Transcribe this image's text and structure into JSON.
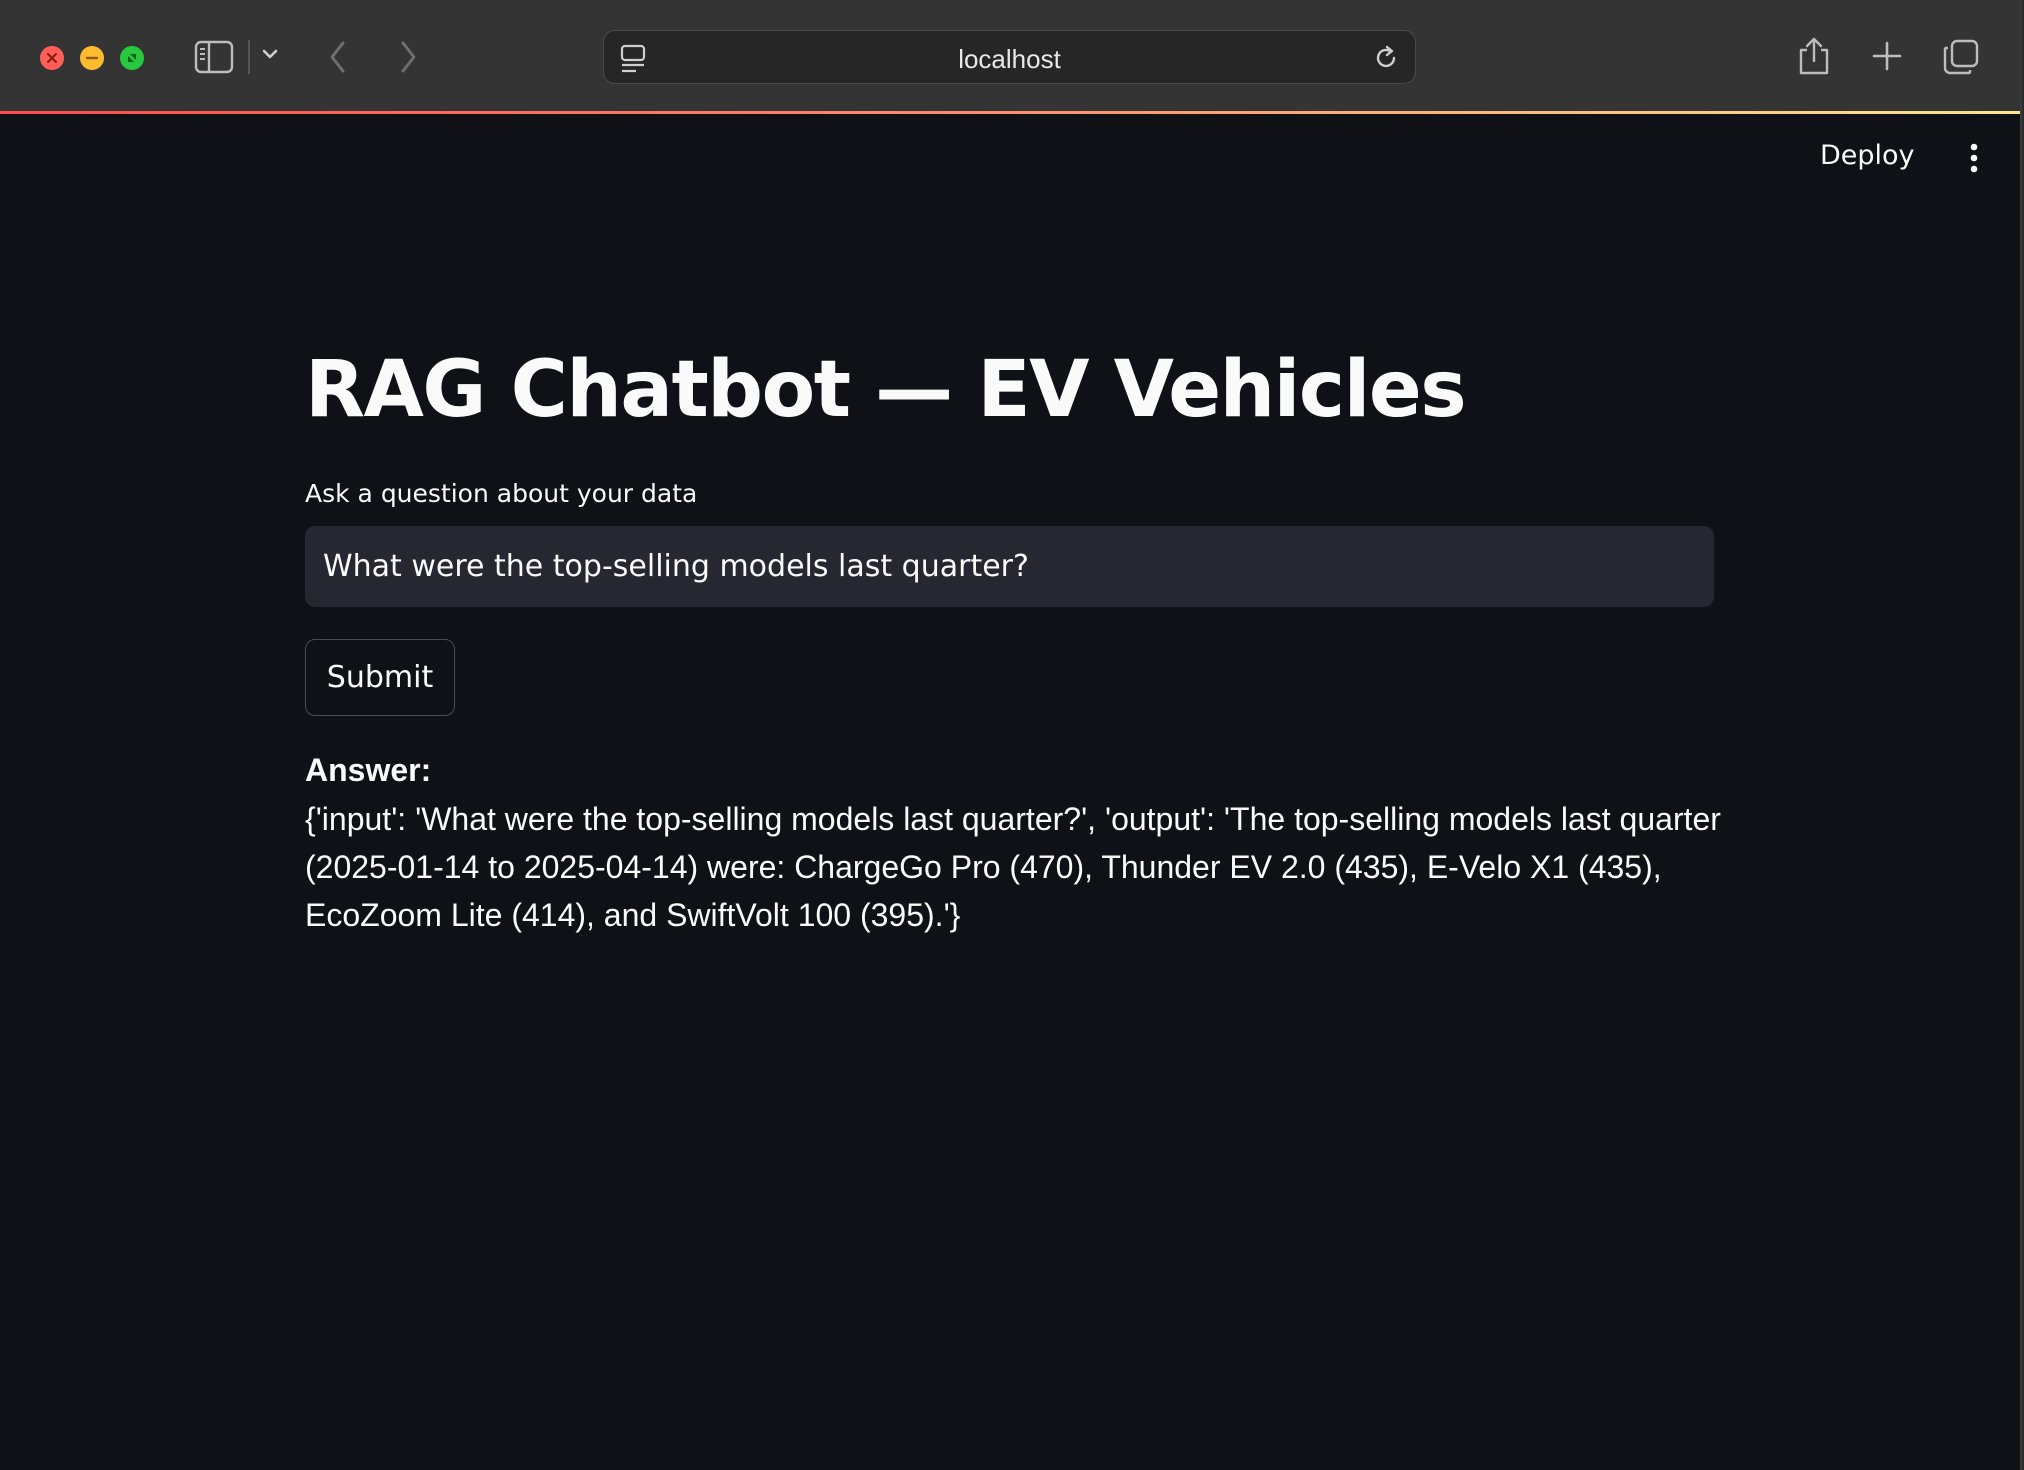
{
  "browser": {
    "url": "localhost"
  },
  "app": {
    "deploy_label": "Deploy",
    "title": "RAG Chatbot — EV Vehicles",
    "input_label": "Ask a question about your data",
    "input_value": "What were the top-selling models last quarter?",
    "submit_label": "Submit",
    "answer_label": "Answer:",
    "answer_text": "{'input': 'What were the top-selling models last quarter?', 'output': 'The top-selling models last quarter (2025-01-14 to 2025-04-14) were: ChargeGo Pro (470), Thunder EV 2.0 (435), E-Velo X1 (435), EcoZoom Lite (414), and SwiftVolt 100 (395).'}"
  },
  "colors": {
    "background": "#0f1117",
    "input_background": "#262730",
    "text": "#fafafa",
    "accent_gradient_start": "#ff4b4b",
    "accent_gradient_end": "#ffe58a"
  },
  "icons": {
    "traffic_lights": [
      "close-icon",
      "minimize-icon",
      "zoom-icon"
    ],
    "toolbar": [
      "sidebar-toggle-icon",
      "chevron-down-icon",
      "back-arrow-icon",
      "forward-arrow-icon",
      "share-icon",
      "new-tab-plus-icon",
      "tab-overview-icon"
    ],
    "url_bar": [
      "page-menu-icon",
      "reload-icon"
    ],
    "app": [
      "kebab-menu-icon"
    ]
  }
}
